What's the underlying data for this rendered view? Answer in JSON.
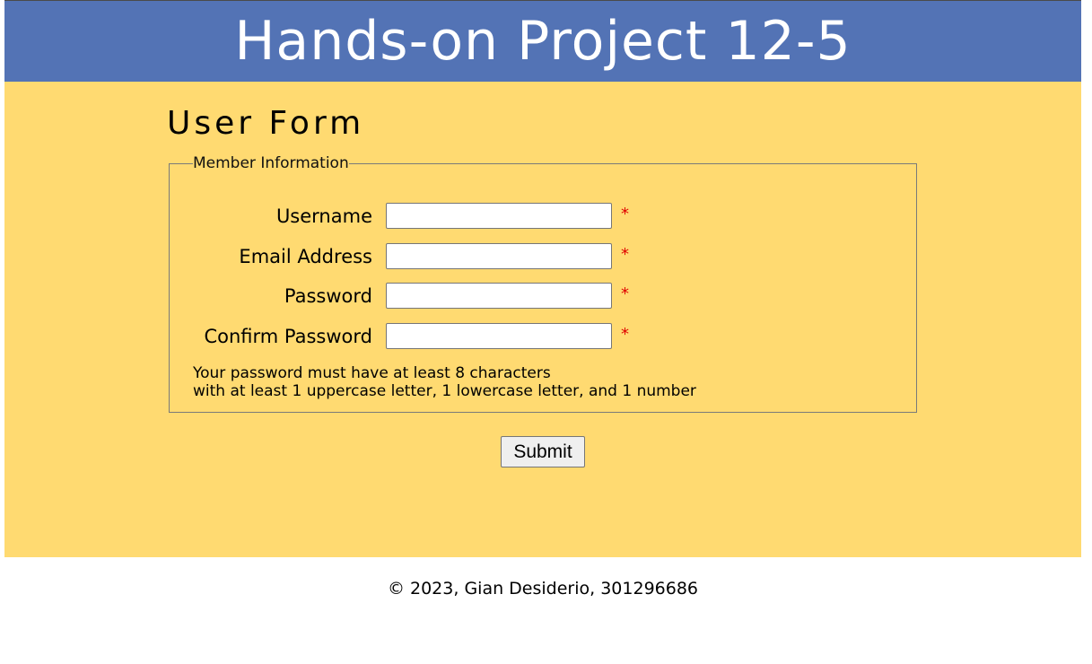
{
  "header": {
    "title": "Hands-on Project 12-5"
  },
  "form": {
    "title": "User Form",
    "legend": "Member Information",
    "fields": [
      {
        "label": "Username",
        "value": "",
        "required_mark": "*"
      },
      {
        "label": "Email Address",
        "value": "",
        "required_mark": "*"
      },
      {
        "label": "Password",
        "value": "",
        "required_mark": "*"
      },
      {
        "label": "Confirm Password",
        "value": "",
        "required_mark": "*"
      }
    ],
    "note_line1": "Your password must have at least 8 characters",
    "note_line2": "with at least 1 uppercase letter, 1 lowercase letter, and 1 number",
    "submit_label": "Submit"
  },
  "footer": {
    "text": "© 2023, Gian Desiderio, 301296686"
  },
  "colors": {
    "header_bg": "#5373b5",
    "main_bg": "#ffda71",
    "required": "#e00000"
  }
}
